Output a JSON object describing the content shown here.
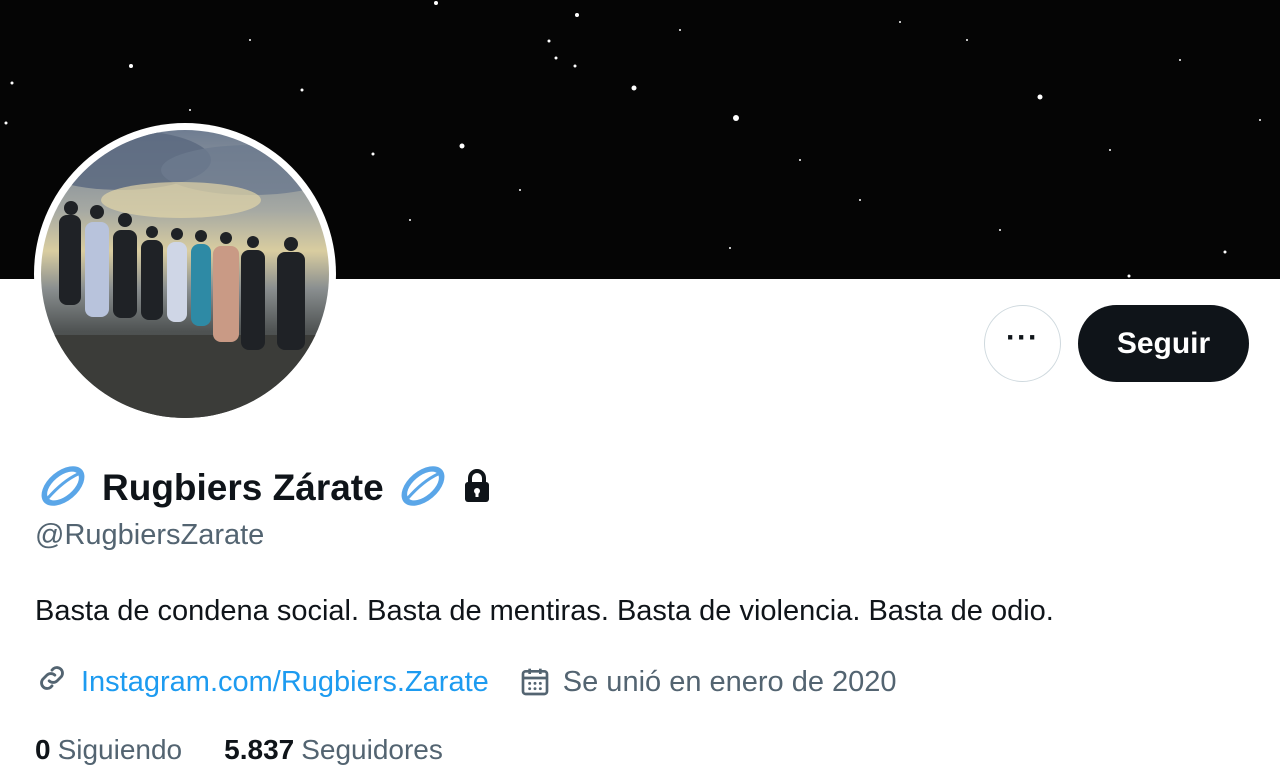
{
  "profile": {
    "display_name": "Rugbiers Zárate",
    "handle": "@RugbiersZarate",
    "bio": "Basta de condena social. Basta de mentiras. Basta de violencia. Basta de odio.",
    "website": "Instagram.com/Rugbiers.Zarate",
    "joined": "Se unió en enero de 2020",
    "following_count": "0",
    "following_label": "Siguiendo",
    "followers_count": "5.837",
    "followers_label": "Seguidores",
    "protected": true
  },
  "actions": {
    "more_label": "···",
    "follow_label": "Seguir"
  },
  "icons": {
    "name_emoji": "rugby-ball-icon",
    "lock": "lock-icon",
    "link": "link-icon",
    "calendar": "calendar-icon",
    "more": "more-icon"
  },
  "colors": {
    "text_primary": "#0f1419",
    "text_secondary": "#536471",
    "link": "#1d9bf0",
    "follow_button_bg": "#0f1419",
    "banner_bg": "#050505"
  }
}
